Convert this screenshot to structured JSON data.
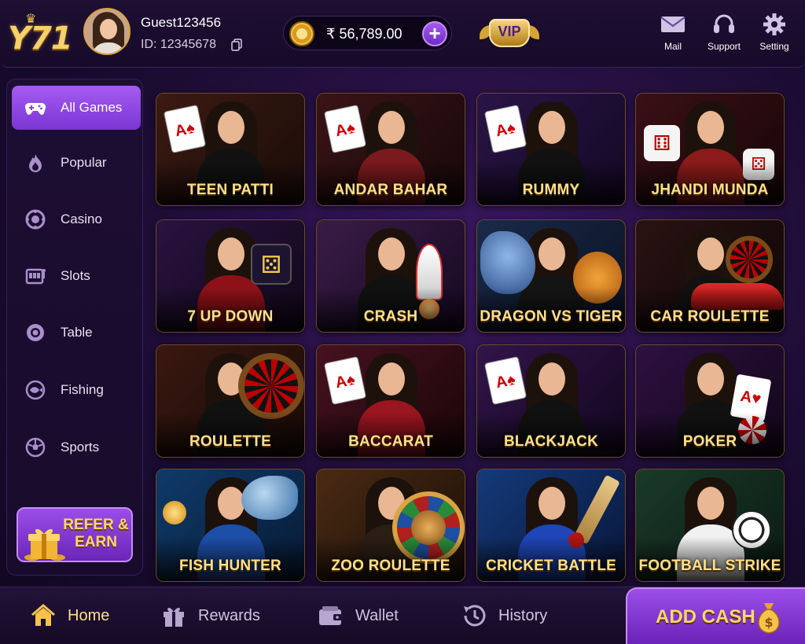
{
  "header": {
    "logo_text": "Y71",
    "username": "Guest123456",
    "user_id": "ID: 12345678",
    "balance": "₹ 56,789.00",
    "add_symbol": "+",
    "vip_label": "VIP",
    "actions": [
      {
        "label": "Mail",
        "icon": "mail-icon"
      },
      {
        "label": "Support",
        "icon": "headset-icon"
      },
      {
        "label": "Setting",
        "icon": "gear-icon"
      }
    ]
  },
  "sidebar": {
    "items": [
      {
        "label": "All Games",
        "icon": "gamepad-icon",
        "active": true
      },
      {
        "label": "Popular",
        "icon": "flame-icon",
        "active": false
      },
      {
        "label": "Casino",
        "icon": "chip-icon",
        "active": false
      },
      {
        "label": "Slots",
        "icon": "slot-machine-icon",
        "active": false
      },
      {
        "label": "Table",
        "icon": "table-chip-icon",
        "active": false
      },
      {
        "label": "Fishing",
        "icon": "fish-icon",
        "active": false
      },
      {
        "label": "Sports",
        "icon": "soccer-ball-icon",
        "active": false
      }
    ],
    "refer_line1": "REFER &",
    "refer_line2": "EARN"
  },
  "games": [
    {
      "title": "TEEN PATTI"
    },
    {
      "title": "ANDAR BAHAR"
    },
    {
      "title": "RUMMY"
    },
    {
      "title": "JHANDI MUNDA"
    },
    {
      "title": "7 UP DOWN"
    },
    {
      "title": "CRASH"
    },
    {
      "title": "DRAGON VS TIGER"
    },
    {
      "title": "CAR ROULETTE"
    },
    {
      "title": "ROULETTE"
    },
    {
      "title": "BACCARAT"
    },
    {
      "title": "BLACKJACK"
    },
    {
      "title": "POKER"
    },
    {
      "title": "FISH HUNTER"
    },
    {
      "title": "ZOO ROULETTE"
    },
    {
      "title": "CRICKET BATTLE"
    },
    {
      "title": "FOOTBALL STRIKE"
    }
  ],
  "bottom_nav": {
    "tabs": [
      {
        "label": "Home",
        "icon": "home-icon",
        "active": true
      },
      {
        "label": "Rewards",
        "icon": "gift-icon",
        "active": false
      },
      {
        "label": "Wallet",
        "icon": "wallet-icon",
        "active": false
      },
      {
        "label": "History",
        "icon": "history-icon",
        "active": false
      }
    ],
    "add_cash": "ADD CASH"
  },
  "colors": {
    "accent": "#9b4ee8",
    "gold": "#ffe08a",
    "background": "#1c0c33"
  }
}
